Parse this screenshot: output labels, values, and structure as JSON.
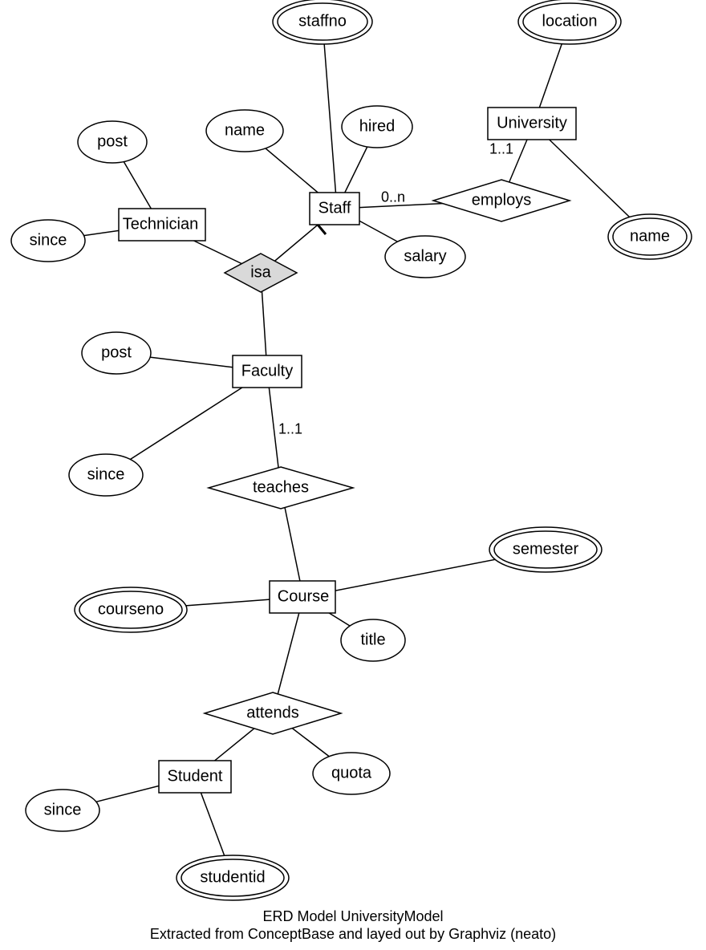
{
  "chart_data": {
    "type": "er-diagram",
    "title": "ERD Model UniversityModel",
    "subtitle": "Extracted from ConceptBase and layed out by Graphviz (neato)",
    "entities": [
      "Technician",
      "Staff",
      "University",
      "Faculty",
      "Course",
      "Student"
    ],
    "isa": {
      "supertype": "Staff",
      "subtypes": [
        "Technician",
        "Faculty"
      ]
    },
    "relationships": [
      {
        "name": "employs",
        "participants": [
          {
            "entity": "Staff",
            "cardinality": "0..n"
          },
          {
            "entity": "University",
            "cardinality": "1..1"
          }
        ]
      },
      {
        "name": "teaches",
        "participants": [
          {
            "entity": "Faculty",
            "cardinality": "1..1"
          },
          {
            "entity": "Course"
          }
        ]
      },
      {
        "name": "attends",
        "participants": [
          {
            "entity": "Course"
          },
          {
            "entity": "Student"
          }
        ],
        "attributes": [
          "quota"
        ]
      }
    ],
    "attributes": {
      "Technician": [
        {
          "name": "post"
        },
        {
          "name": "since"
        }
      ],
      "Staff": [
        {
          "name": "staffno",
          "key": true
        },
        {
          "name": "name"
        },
        {
          "name": "hired"
        },
        {
          "name": "salary"
        }
      ],
      "University": [
        {
          "name": "location",
          "key": true
        },
        {
          "name": "name",
          "key": true
        }
      ],
      "Faculty": [
        {
          "name": "post"
        },
        {
          "name": "since"
        }
      ],
      "Course": [
        {
          "name": "courseno",
          "key": true
        },
        {
          "name": "semester",
          "key": true
        },
        {
          "name": "title"
        }
      ],
      "Student": [
        {
          "name": "since"
        },
        {
          "name": "studentid",
          "key": true
        }
      ]
    }
  },
  "nodes": {
    "technician": {
      "label": "Technician"
    },
    "tech_post": {
      "label": "post"
    },
    "tech_since": {
      "label": "since"
    },
    "staff": {
      "label": "Staff"
    },
    "staff_name": {
      "label": "name"
    },
    "staff_staffno": {
      "label": "staffno"
    },
    "staff_hired": {
      "label": "hired"
    },
    "staff_salary": {
      "label": "salary"
    },
    "isa": {
      "label": "isa"
    },
    "university": {
      "label": "University"
    },
    "uni_location": {
      "label": "location"
    },
    "uni_name": {
      "label": "name"
    },
    "employs": {
      "label": "employs"
    },
    "faculty": {
      "label": "Faculty"
    },
    "fac_post": {
      "label": "post"
    },
    "fac_since": {
      "label": "since"
    },
    "teaches": {
      "label": "teaches"
    },
    "course": {
      "label": "Course"
    },
    "courseno": {
      "label": "courseno"
    },
    "semester": {
      "label": "semester"
    },
    "title": {
      "label": "title"
    },
    "attends": {
      "label": "attends"
    },
    "quota": {
      "label": "quota"
    },
    "student": {
      "label": "Student"
    },
    "stu_since": {
      "label": "since"
    },
    "studentid": {
      "label": "studentid"
    }
  },
  "edges": {
    "staff_employs": {
      "label": "0..n"
    },
    "uni_employs": {
      "label": "1..1"
    },
    "fac_teaches": {
      "label": "1..1"
    }
  },
  "caption": {
    "line1": "ERD Model UniversityModel",
    "line2": "Extracted from ConceptBase and layed out by Graphviz (neato)"
  }
}
